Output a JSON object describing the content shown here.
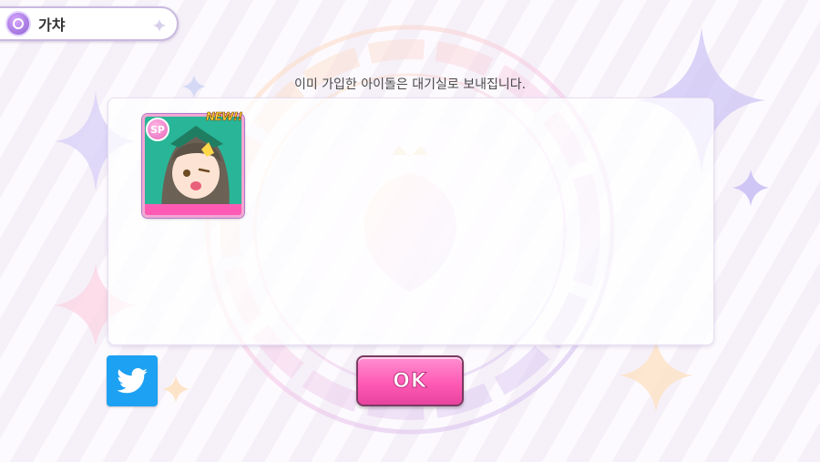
{
  "header": {
    "title": "가챠",
    "icon": "gacha-orb-icon"
  },
  "notice": "이미 가입한 아이돌은 대기실로 보내집니다.",
  "results": [
    {
      "badge": "NEW!!",
      "attribute_icon": "vocal-attribute-icon",
      "attribute_label": "SP"
    }
  ],
  "buttons": {
    "ok_label": "OK",
    "share_icon": "twitter-icon"
  },
  "colors": {
    "ok_button": "#ff5bb5",
    "twitter": "#1da1f2",
    "card_border": "#f2a7d3"
  }
}
